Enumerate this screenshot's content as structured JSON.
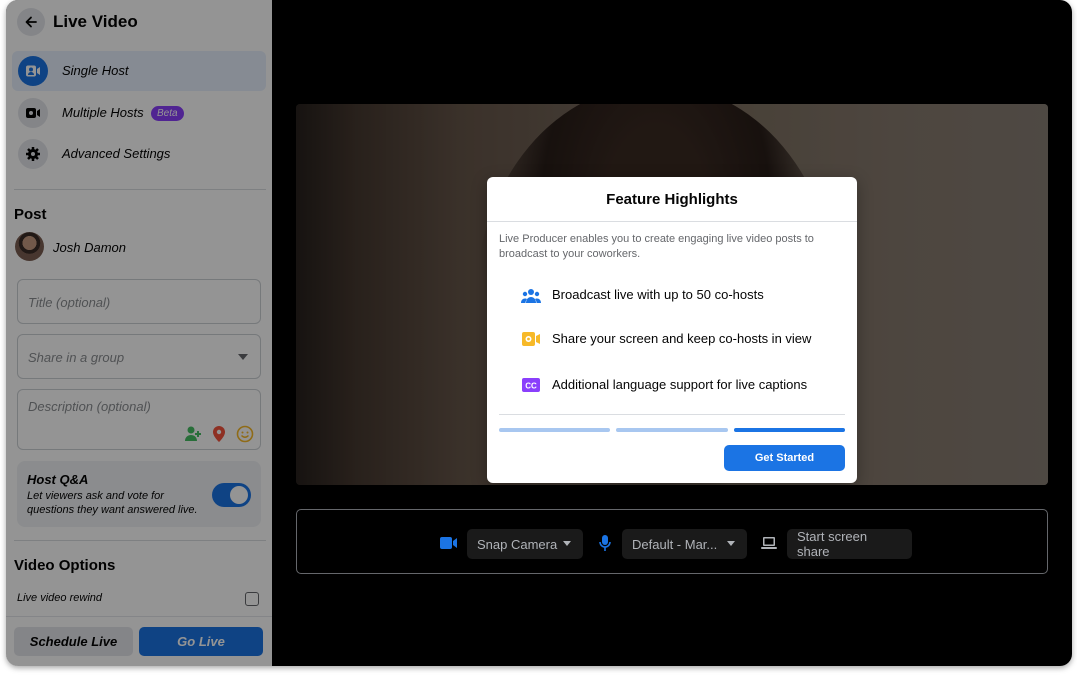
{
  "sidebar": {
    "title": "Live Video",
    "modes": [
      {
        "label": "Single Host",
        "icon": "camera-user-icon"
      },
      {
        "label": "Multiple Hosts",
        "icon": "video-camera-icon",
        "badge": "Beta"
      },
      {
        "label": "Advanced Settings",
        "icon": "gear-icon"
      }
    ],
    "post": {
      "heading": "Post",
      "author": "Josh Damon",
      "title_placeholder": "Title (optional)",
      "group_placeholder": "Share in a group",
      "description_placeholder": "Description (optional)"
    },
    "qa": {
      "title": "Host Q&A",
      "description": "Let viewers ask and vote for questions they want answered live.",
      "enabled": true
    },
    "video_options": {
      "heading": "Video Options",
      "rewind_label": "Live video rewind",
      "rewind_checked": false
    },
    "footer": {
      "schedule_label": "Schedule Live",
      "go_live_label": "Go Live"
    }
  },
  "controls": {
    "camera_label": "Snap Camera",
    "mic_label": "Default - Mar...",
    "screen_share_label": "Start screen share"
  },
  "modal": {
    "title": "Feature Highlights",
    "intro": "Live Producer enables you to create engaging live video posts to broadcast to your coworkers.",
    "features": [
      {
        "icon": "people-icon",
        "text": "Broadcast live with up to 50 co-hosts"
      },
      {
        "icon": "screen-share-icon",
        "text": "Share your screen and keep co-hosts in view"
      },
      {
        "icon": "captions-icon",
        "text": "Additional language support for live captions"
      }
    ],
    "steps_total": 3,
    "step_current": 3,
    "button_label": "Get Started"
  },
  "colors": {
    "accent": "#1b74e4",
    "beta_badge": "#8a3ffc",
    "screen_share_icon": "#f7b928",
    "captions_icon": "#8a3ffc",
    "step_inactive": "#a8c7f0"
  }
}
